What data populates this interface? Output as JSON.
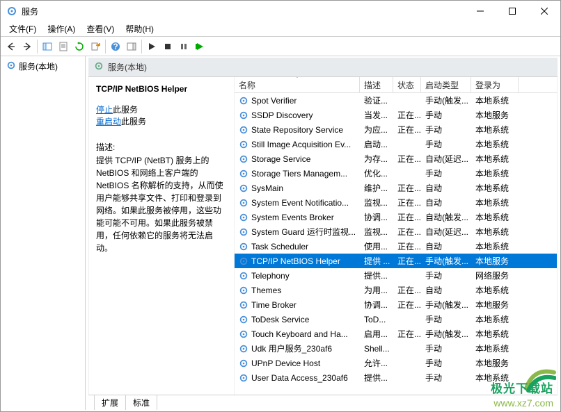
{
  "window": {
    "title": "服务"
  },
  "menu": {
    "file": "文件(F)",
    "action": "操作(A)",
    "view": "查看(V)",
    "help": "帮助(H)"
  },
  "leftnav": {
    "label": "服务(本地)"
  },
  "panel": {
    "title": "服务(本地)"
  },
  "detail": {
    "selected_name": "TCP/IP NetBIOS Helper",
    "stop_link": "停止",
    "stop_suffix": "此服务",
    "restart_link": "重启动",
    "restart_suffix": "此服务",
    "desc_label": "描述:",
    "desc_text": "提供 TCP/IP (NetBT) 服务上的 NetBIOS 和网络上客户端的 NetBIOS 名称解析的支持，从而使用户能够共享文件、打印和登录到网络。如果此服务被停用，这些功能可能不可用。如果此服务被禁用，任何依赖它的服务将无法启动。"
  },
  "columns": {
    "name": "名称",
    "desc": "描述",
    "status": "状态",
    "start": "启动类型",
    "logon": "登录为"
  },
  "services": [
    {
      "name": "Spot Verifier",
      "desc": "验证...",
      "status": "",
      "start": "手动(触发...",
      "logon": "本地系统"
    },
    {
      "name": "SSDP Discovery",
      "desc": "当发...",
      "status": "正在...",
      "start": "手动",
      "logon": "本地服务"
    },
    {
      "name": "State Repository Service",
      "desc": "为应...",
      "status": "正在...",
      "start": "手动",
      "logon": "本地系统"
    },
    {
      "name": "Still Image Acquisition Ev...",
      "desc": "启动...",
      "status": "",
      "start": "手动",
      "logon": "本地系统"
    },
    {
      "name": "Storage Service",
      "desc": "为存...",
      "status": "正在...",
      "start": "自动(延迟...",
      "logon": "本地系统"
    },
    {
      "name": "Storage Tiers Managem...",
      "desc": "优化...",
      "status": "",
      "start": "手动",
      "logon": "本地系统"
    },
    {
      "name": "SysMain",
      "desc": "维护...",
      "status": "正在...",
      "start": "自动",
      "logon": "本地系统"
    },
    {
      "name": "System Event Notificatio...",
      "desc": "监视...",
      "status": "正在...",
      "start": "自动",
      "logon": "本地系统"
    },
    {
      "name": "System Events Broker",
      "desc": "协调...",
      "status": "正在...",
      "start": "自动(触发...",
      "logon": "本地系统"
    },
    {
      "name": "System Guard 运行时监视...",
      "desc": "监视...",
      "status": "正在...",
      "start": "自动(延迟...",
      "logon": "本地系统"
    },
    {
      "name": "Task Scheduler",
      "desc": "使用...",
      "status": "正在...",
      "start": "自动",
      "logon": "本地系统"
    },
    {
      "name": "TCP/IP NetBIOS Helper",
      "desc": "提供 ...",
      "status": "正在...",
      "start": "手动(触发...",
      "logon": "本地服务",
      "selected": true
    },
    {
      "name": "Telephony",
      "desc": "提供...",
      "status": "",
      "start": "手动",
      "logon": "网络服务"
    },
    {
      "name": "Themes",
      "desc": "为用...",
      "status": "正在...",
      "start": "自动",
      "logon": "本地系统"
    },
    {
      "name": "Time Broker",
      "desc": "协调...",
      "status": "正在...",
      "start": "手动(触发...",
      "logon": "本地服务"
    },
    {
      "name": "ToDesk Service",
      "desc": "ToD...",
      "status": "",
      "start": "手动",
      "logon": "本地系统"
    },
    {
      "name": "Touch Keyboard and Ha...",
      "desc": "启用...",
      "status": "正在...",
      "start": "手动(触发...",
      "logon": "本地系统"
    },
    {
      "name": "Udk 用户服务_230af6",
      "desc": "Shell...",
      "status": "",
      "start": "手动",
      "logon": "本地系统"
    },
    {
      "name": "UPnP Device Host",
      "desc": "允许...",
      "status": "",
      "start": "手动",
      "logon": "本地服务"
    },
    {
      "name": "User Data Access_230af6",
      "desc": "提供...",
      "status": "",
      "start": "手动",
      "logon": "本地系统"
    }
  ],
  "tabs": {
    "extended": "扩展",
    "standard": "标准"
  },
  "watermark": {
    "brand": "极光下载站",
    "url": "www.xz7.com"
  }
}
